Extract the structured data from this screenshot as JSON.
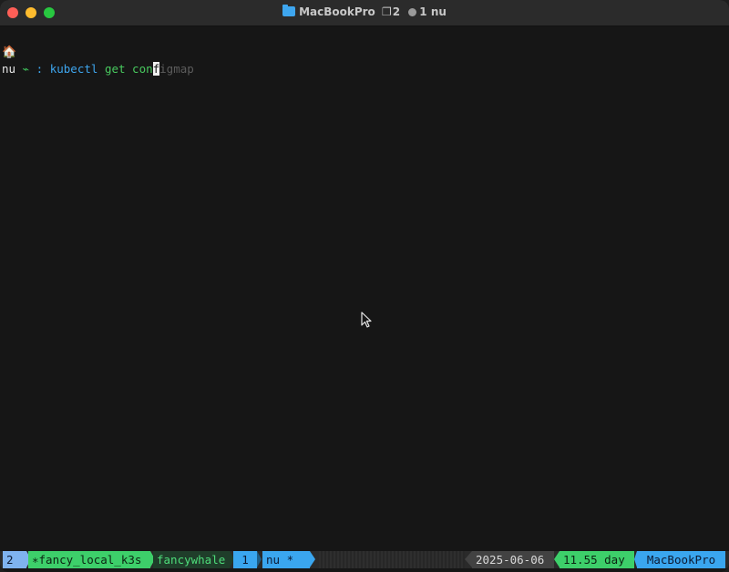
{
  "window": {
    "title_host": "MacBookPro",
    "title_tabs": "2",
    "title_panes": "1 nu"
  },
  "terminal": {
    "home_glyph": "🏠",
    "prompt_name": "nu",
    "prompt_arrow": "⌁",
    "prompt_colon": ":",
    "command": "kubectl",
    "arg1": "get",
    "typed": "con",
    "cursor_char": "f",
    "hint": "igmap"
  },
  "status": {
    "window_index": "2",
    "session": "∗fancy_local_k3s",
    "context": "fancywhale",
    "pane_index": "1",
    "pane_name": "nu *",
    "date": "2025-06-06",
    "uptime": "11.55 day",
    "hostname": "MacBookPro"
  },
  "colors": {
    "accent_blue": "#3aa6ef",
    "accent_green": "#3dcf6a",
    "background": "#161616"
  },
  "icons": {
    "folder": "folder-icon",
    "home": "home-icon",
    "mouse": "mouse-pointer-icon"
  }
}
